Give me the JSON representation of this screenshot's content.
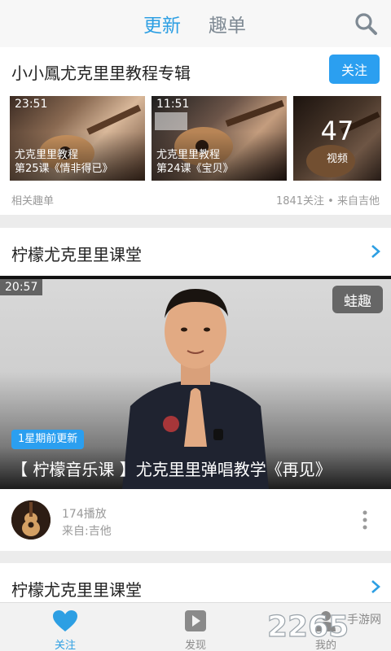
{
  "header": {
    "tabs": [
      {
        "label": "更新",
        "active": true
      },
      {
        "label": "趣单",
        "active": false
      }
    ]
  },
  "album": {
    "title": "小小鳳尤克里里教程专辑",
    "follow_label": "关注",
    "thumbs": [
      {
        "duration": "23:51",
        "line1": "尤克里里教程",
        "line2": "第25课《情非得已》"
      },
      {
        "duration": "11:51",
        "line1": "尤克里里教程",
        "line2": "第24课《宝贝》"
      }
    ],
    "video_count": "47",
    "video_count_label": "视频",
    "footer_left": "相关趣单",
    "footer_right": "1841关注 • 来自吉他"
  },
  "section1": {
    "title": "柠檬尤克里里课堂"
  },
  "video": {
    "duration": "20:57",
    "watermark": "蛙趣",
    "badge": "1星期前更新",
    "title": "【 柠檬音乐课 】尤克里里弹唱教学《再见》",
    "plays": "174播放",
    "source": "来自:吉他"
  },
  "section2": {
    "title": "柠檬尤克里里课堂"
  },
  "nav": {
    "items": [
      {
        "label": "关注",
        "active": true
      },
      {
        "label": "发现",
        "active": false
      },
      {
        "label": "我的",
        "active": false
      }
    ]
  },
  "logo_text": "2265",
  "logo_sub": "手游网",
  "colors": {
    "accent": "#2d9fe3",
    "button": "#2b9ff0"
  }
}
